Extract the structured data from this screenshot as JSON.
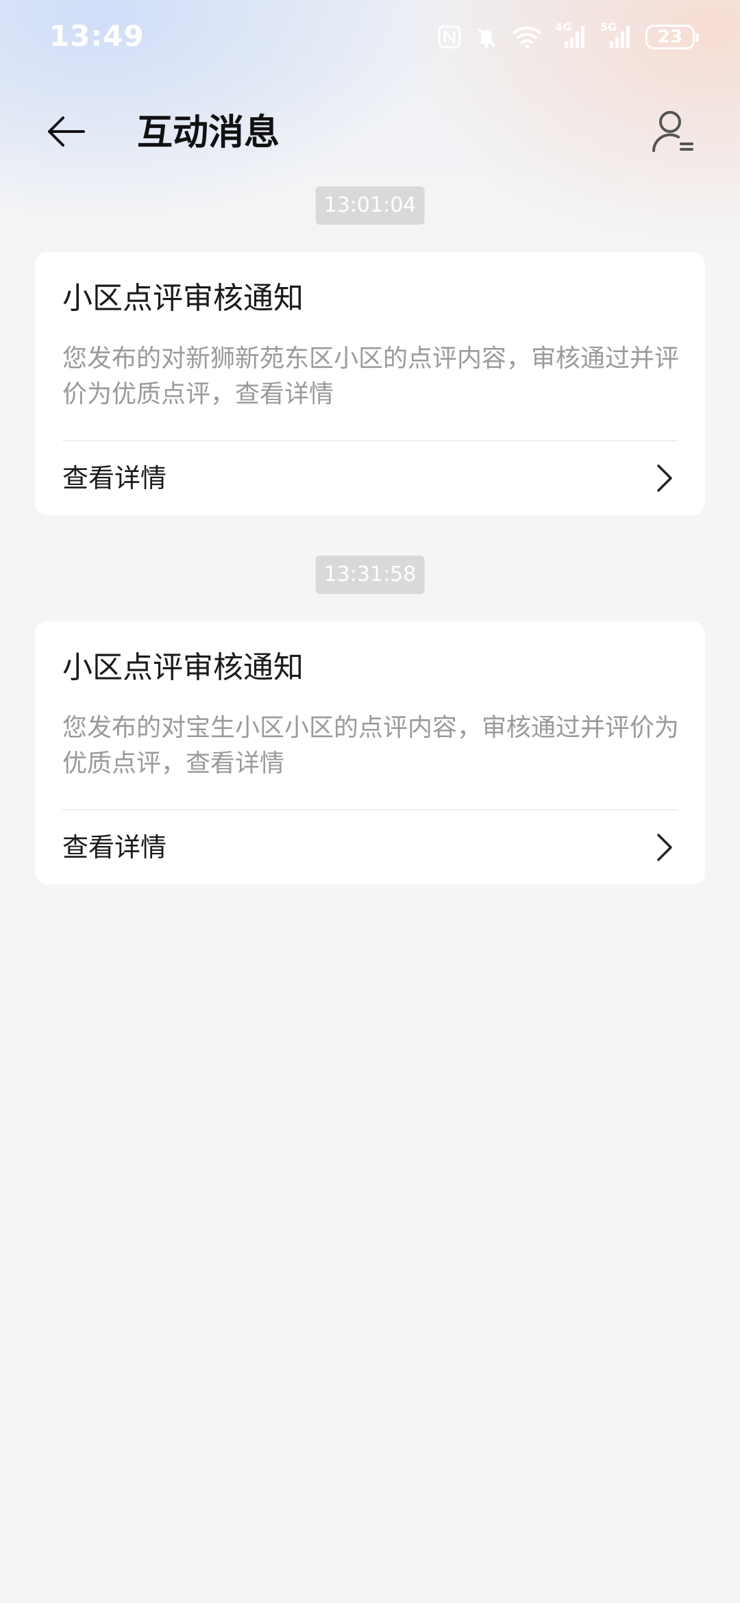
{
  "status_bar": {
    "time": "13:49",
    "battery": "23",
    "network_4g": "4G",
    "network_5g": "5G"
  },
  "header": {
    "title": "互动消息"
  },
  "messages": [
    {
      "timestamp": "13:01:04",
      "title": "小区点评审核通知",
      "body": "您发布的对新狮新苑东区小区的点评内容，审核通过并评价为优质点评，查看详情",
      "action_label": "查看详情"
    },
    {
      "timestamp": "13:31:58",
      "title": "小区点评审核通知",
      "body": "您发布的对宝生小区小区的点评内容，审核通过并评价为优质点评，查看详情",
      "action_label": "查看详情"
    }
  ],
  "icons": {
    "back": "arrow-left-icon",
    "profile": "user-list-icon",
    "chevron": "chevron-right-icon",
    "nfc": "nfc-icon",
    "mute": "bell-off-icon",
    "wifi": "wifi-icon",
    "signal": "signal-icon"
  }
}
